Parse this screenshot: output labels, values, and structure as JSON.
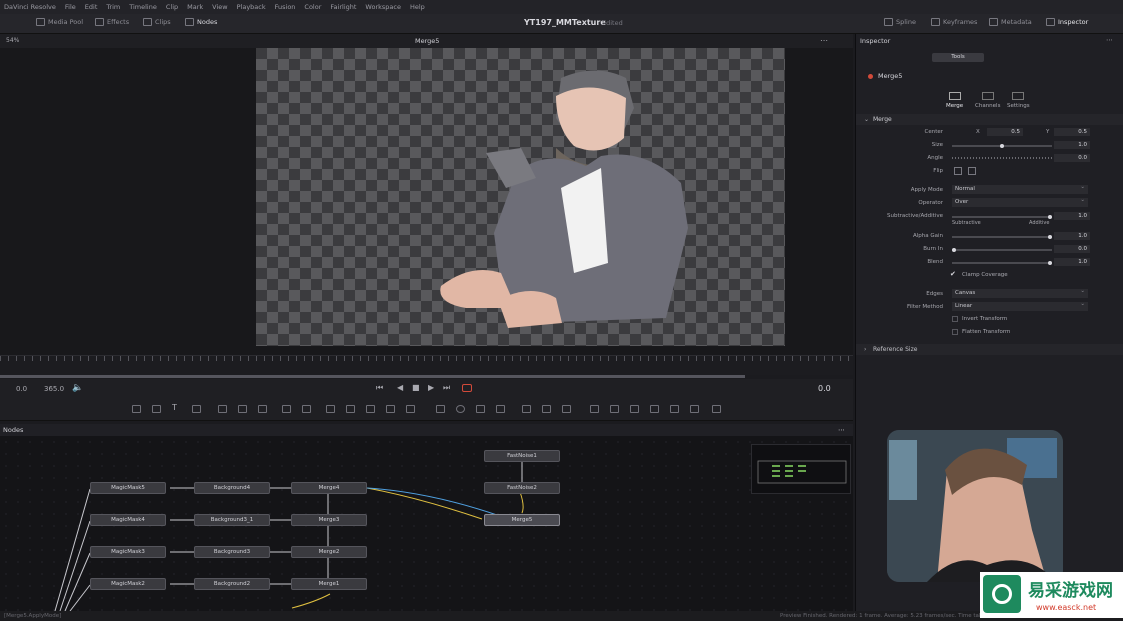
{
  "menu": [
    "DaVinci Resolve",
    "File",
    "Edit",
    "Trim",
    "Timeline",
    "Clip",
    "Mark",
    "View",
    "Playback",
    "Fusion",
    "Color",
    "Fairlight",
    "Workspace",
    "Help"
  ],
  "toolbar": {
    "media_pool": "Media Pool",
    "effects": "Effects",
    "clips": "Clips",
    "nodes": "Nodes",
    "project_title": "YT197_MMTexture",
    "project_state": "Edited",
    "spline": "Spline",
    "keyframes": "Keyframes",
    "metadata": "Metadata",
    "inspector": "Inspector"
  },
  "viewer": {
    "zoom": "54%",
    "title": "Merge5",
    "timecode_start": "0.0",
    "timecode_end": "365.0",
    "current_frame": "0.0"
  },
  "nodes_panel": {
    "title": "Nodes",
    "nodes": {
      "magicmask5": "MagicMask5",
      "magicmask4": "MagicMask4",
      "magicmask3": "MagicMask3",
      "magicmask2": "MagicMask2",
      "background4": "Background4",
      "background3_1": "Background3_1",
      "background3": "Background3",
      "background2": "Background2",
      "merge4": "Merge4",
      "merge3": "Merge3",
      "merge2": "Merge2",
      "merge1": "Merge1",
      "fastnoise1": "FastNoise1",
      "fastnoise2": "FastNoise2",
      "merge5": "Merge5"
    }
  },
  "inspector": {
    "title": "Inspector",
    "tool_tab": "Tools",
    "node_name": "Merge5",
    "tabs": [
      "Merge",
      "Channels",
      "Settings"
    ],
    "section": "Merge",
    "center_label": "Center",
    "center_x_label": "X",
    "center_x": "0.5",
    "center_y_label": "Y",
    "center_y": "0.5",
    "size_label": "Size",
    "size": "1.0",
    "angle_label": "Angle",
    "angle": "0.0",
    "flip_label": "Flip",
    "apply_mode_label": "Apply Mode",
    "apply_mode": "Normal",
    "operator_label": "Operator",
    "operator": "Over",
    "subadd_label": "Subtractive/Additive",
    "subadd": "1.0",
    "subtractive": "Subtractive",
    "additive": "Additive",
    "alpha_gain_label": "Alpha Gain",
    "alpha_gain": "1.0",
    "burn_in_label": "Burn In",
    "burn_in": "0.0",
    "blend_label": "Blend",
    "blend": "1.0",
    "clamp_label": "Clamp Coverage",
    "edges_label": "Edges",
    "edges": "Canvas",
    "filter_label": "Filter Method",
    "filter": "Linear",
    "invert_label": "Invert Transform",
    "flatten_label": "Flatten Transform",
    "reference_size": "Reference Size"
  },
  "status": {
    "left": "[Merge5.ApplyMode]",
    "right": "Preview Finished. Rendered: 1 frame. Average: 5.23 frames/sec. Time taken: 0.0"
  },
  "watermark": {
    "text": "易采游戏网",
    "url": "www.easck.net"
  }
}
